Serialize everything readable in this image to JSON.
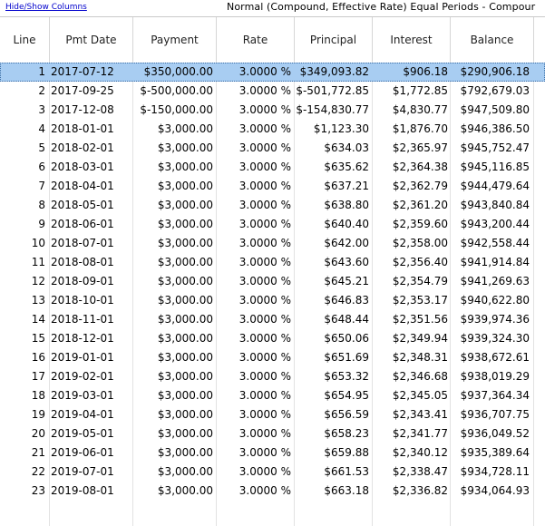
{
  "toolbar": {
    "toggle_label": "Hide/Show Columns",
    "title": "Normal (Compound, Effective Rate) Equal Periods - Compour"
  },
  "columns": [
    "Line",
    "Pmt Date",
    "Payment",
    "Rate",
    "Principal",
    "Interest",
    "Balance"
  ],
  "selected_line": "1",
  "rows": [
    [
      "1",
      "2017-07-12",
      "$350,000.00",
      "3.0000 %",
      "$349,093.82",
      "$906.18",
      "$290,906.18"
    ],
    [
      "2",
      "2017-09-25",
      "$-500,000.00",
      "3.0000 %",
      "$-501,772.85",
      "$1,772.85",
      "$792,679.03"
    ],
    [
      "3",
      "2017-12-08",
      "$-150,000.00",
      "3.0000 %",
      "$-154,830.77",
      "$4,830.77",
      "$947,509.80"
    ],
    [
      "4",
      "2018-01-01",
      "$3,000.00",
      "3.0000 %",
      "$1,123.30",
      "$1,876.70",
      "$946,386.50"
    ],
    [
      "5",
      "2018-02-01",
      "$3,000.00",
      "3.0000 %",
      "$634.03",
      "$2,365.97",
      "$945,752.47"
    ],
    [
      "6",
      "2018-03-01",
      "$3,000.00",
      "3.0000 %",
      "$635.62",
      "$2,364.38",
      "$945,116.85"
    ],
    [
      "7",
      "2018-04-01",
      "$3,000.00",
      "3.0000 %",
      "$637.21",
      "$2,362.79",
      "$944,479.64"
    ],
    [
      "8",
      "2018-05-01",
      "$3,000.00",
      "3.0000 %",
      "$638.80",
      "$2,361.20",
      "$943,840.84"
    ],
    [
      "9",
      "2018-06-01",
      "$3,000.00",
      "3.0000 %",
      "$640.40",
      "$2,359.60",
      "$943,200.44"
    ],
    [
      "10",
      "2018-07-01",
      "$3,000.00",
      "3.0000 %",
      "$642.00",
      "$2,358.00",
      "$942,558.44"
    ],
    [
      "11",
      "2018-08-01",
      "$3,000.00",
      "3.0000 %",
      "$643.60",
      "$2,356.40",
      "$941,914.84"
    ],
    [
      "12",
      "2018-09-01",
      "$3,000.00",
      "3.0000 %",
      "$645.21",
      "$2,354.79",
      "$941,269.63"
    ],
    [
      "13",
      "2018-10-01",
      "$3,000.00",
      "3.0000 %",
      "$646.83",
      "$2,353.17",
      "$940,622.80"
    ],
    [
      "14",
      "2018-11-01",
      "$3,000.00",
      "3.0000 %",
      "$648.44",
      "$2,351.56",
      "$939,974.36"
    ],
    [
      "15",
      "2018-12-01",
      "$3,000.00",
      "3.0000 %",
      "$650.06",
      "$2,349.94",
      "$939,324.30"
    ],
    [
      "16",
      "2019-01-01",
      "$3,000.00",
      "3.0000 %",
      "$651.69",
      "$2,348.31",
      "$938,672.61"
    ],
    [
      "17",
      "2019-02-01",
      "$3,000.00",
      "3.0000 %",
      "$653.32",
      "$2,346.68",
      "$938,019.29"
    ],
    [
      "18",
      "2019-03-01",
      "$3,000.00",
      "3.0000 %",
      "$654.95",
      "$2,345.05",
      "$937,364.34"
    ],
    [
      "19",
      "2019-04-01",
      "$3,000.00",
      "3.0000 %",
      "$656.59",
      "$2,343.41",
      "$936,707.75"
    ],
    [
      "20",
      "2019-05-01",
      "$3,000.00",
      "3.0000 %",
      "$658.23",
      "$2,341.77",
      "$936,049.52"
    ],
    [
      "21",
      "2019-06-01",
      "$3,000.00",
      "3.0000 %",
      "$659.88",
      "$2,340.12",
      "$935,389.64"
    ],
    [
      "22",
      "2019-07-01",
      "$3,000.00",
      "3.0000 %",
      "$661.53",
      "$2,338.47",
      "$934,728.11"
    ],
    [
      "23",
      "2019-08-01",
      "$3,000.00",
      "3.0000 %",
      "$663.18",
      "$2,336.82",
      "$934,064.93"
    ]
  ],
  "colors": {
    "selection": "#a8cdf2",
    "link": "#0000cc"
  }
}
